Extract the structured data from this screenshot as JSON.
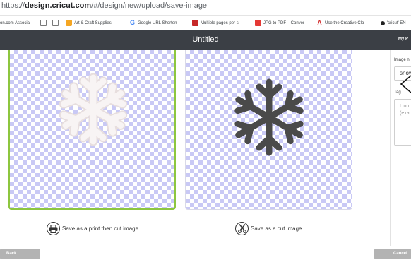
{
  "browser": {
    "url_scheme": "https://",
    "url_host": "design.cricut.com",
    "url_path": "/#/design/new/upload/save-image"
  },
  "bookmarks": [
    {
      "label": "on.com Associa",
      "icon": "none"
    },
    {
      "label": "",
      "icon": "doc-icon"
    },
    {
      "label": "",
      "icon": "doc-icon"
    },
    {
      "label": "Art & Craft Supplies",
      "icon": "cricut-c-icon"
    },
    {
      "label": "Google URL Shorten",
      "icon": "google-g-icon"
    },
    {
      "label": "Multiple pages per s",
      "icon": "red-page-icon"
    },
    {
      "label": "JPG to PDF – Conver",
      "icon": "red-grid-icon"
    },
    {
      "label": "Use the Creative Clo",
      "icon": "adobe-icon"
    },
    {
      "label": "'cricut' EN",
      "icon": "dot-icon"
    }
  ],
  "header": {
    "title": "Untitled",
    "my_projects": "My P"
  },
  "options": {
    "print_then_cut": "Save as a print then cut image",
    "cut_image": "Save as a cut image"
  },
  "sidebar": {
    "image_name_label": "Image n",
    "image_name_value": "snow",
    "tags_label": "Tag",
    "tags_placeholder_1": "Lion",
    "tags_placeholder_2": "(exa"
  },
  "footer": {
    "back": "Back",
    "cancel": "Cancel"
  },
  "colors": {
    "header_bg": "#3b3f45",
    "selected_border": "#8dc63f",
    "checker": "#c9c9f5",
    "button_bg": "#b3b3b3"
  }
}
